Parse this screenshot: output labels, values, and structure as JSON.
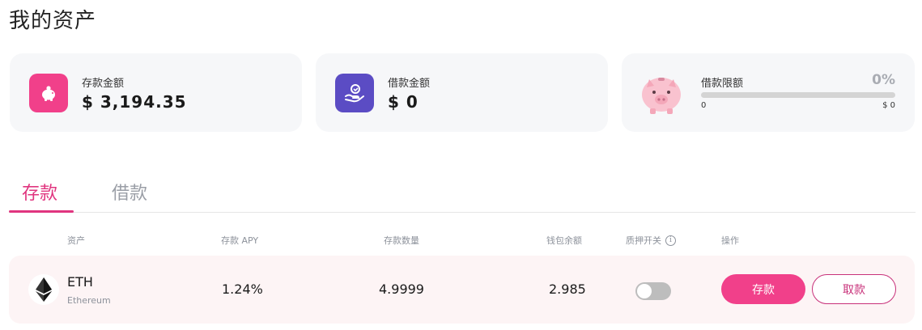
{
  "page": {
    "title": "我的资产"
  },
  "summary": {
    "deposit": {
      "label": "存款金额",
      "value": "$ 3,194.35",
      "icon": "piggy-bank-icon"
    },
    "borrow": {
      "label": "借款金额",
      "value": "$ 0",
      "icon": "hand-coin-icon"
    },
    "limit": {
      "label": "借款限额",
      "percent_text": "0%",
      "progress": 0,
      "min": "0",
      "max": "$ 0",
      "icon": "pink-piggy-icon"
    }
  },
  "tabs": [
    {
      "label": "存款",
      "active": true
    },
    {
      "label": "借款",
      "active": false
    }
  ],
  "table": {
    "headers": {
      "asset": "资产",
      "apy": "存款 APY",
      "qty": "存款数量",
      "wallet": "钱包余额",
      "collateral": "质押开关",
      "action": "操作"
    },
    "rows": [
      {
        "symbol": "ETH",
        "name": "Ethereum",
        "icon": "ethereum-icon",
        "apy": "1.24%",
        "qty": "4.9999",
        "wallet": "2.985",
        "collateral_on": false,
        "deposit_label": "存款",
        "withdraw_label": "取款"
      }
    ]
  },
  "colors": {
    "accent": "#f1408a",
    "accent_dark": "#c8317a",
    "purple": "#5b4cc4",
    "card_bg": "#f6f7f9",
    "row_bg": "#fdf4f5"
  }
}
